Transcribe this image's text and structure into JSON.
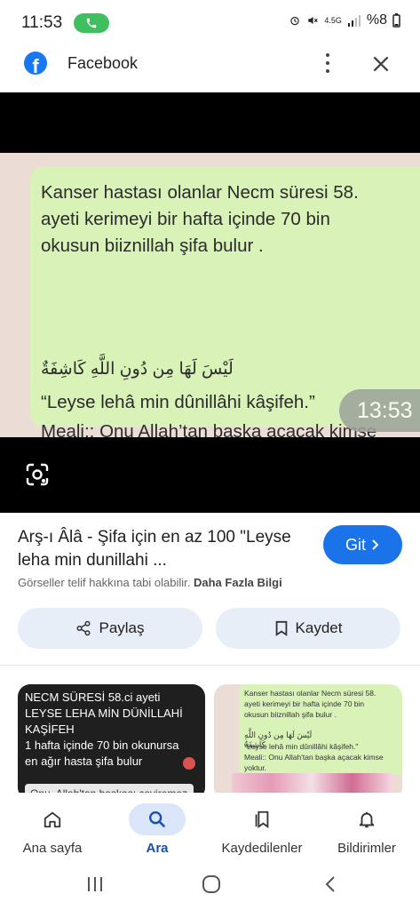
{
  "status_bar": {
    "time": "11:53",
    "battery": "%8",
    "network": "4.5G"
  },
  "header": {
    "title": "Facebook",
    "logo_letter": "f"
  },
  "image": {
    "message_text": "Kanser hastası olanlar Necm süresi 58.\nayeti kerimeyi bir hafta içinde 70 bin\nokusun biiznillah şifa bulur .",
    "arabic_line": "لَيْسَ لَهَا مِن دُونِ اللَّهِ كَاشِفَةٌ",
    "message_text_2": "“Leyse lehâ min dûnillâhi kâşifeh.”\nMeali:: Onu Allah’tan başka açacak kimse\nyoktur.",
    "timestamp": "13:53"
  },
  "result": {
    "title": "Arş-ı Âlâ - Şifa için en az 100 \"Leyse leha min dunillahi ...",
    "go_label": "Git",
    "copyright_notice": "Görseller telif hakkına tabi olabilir.",
    "more_info_link": "Daha Fazla Bilgi",
    "share_label": "Paylaş",
    "save_label": "Kaydet"
  },
  "thumbnails": [
    {
      "text": "NECM SÜRESİ 58.ci ayeti\nLEYSE LEHA MİN DÜNİLLAHİ\nKAŞİFEH\n1 hafta içinde 70 bin okunursa\nen ağır hasta şifa bulur",
      "bottom_text": "Onu, Allah'tan başkası çeviremez"
    },
    {
      "text": "Kanser hastası olanlar Necm süresi 58.\nayeti kerimeyi bir hafta içinde 70 bin\nokusun biiznillah şifa bulur .",
      "arabic_line": "لَيْسَ لَهَا مِن دُونِ اللَّهِ كَاشِفَةٌ",
      "text2": "\"Leyse lehâ min dûnillâhi kâşifeh.\"\nMeali:: Onu Allah'tan başka açacak kimse\nyoktur."
    }
  ],
  "bottom_nav": [
    {
      "label": "Ana sayfa",
      "icon": "home-icon"
    },
    {
      "label": "Ara",
      "icon": "search-icon",
      "active": true
    },
    {
      "label": "Kaydedilenler",
      "icon": "bookmarks-icon"
    },
    {
      "label": "Bildirimler",
      "icon": "bell-icon"
    }
  ],
  "colors": {
    "accent": "#1a73e8",
    "facebook": "#1877f2",
    "bubble": "#d9f2b8"
  }
}
